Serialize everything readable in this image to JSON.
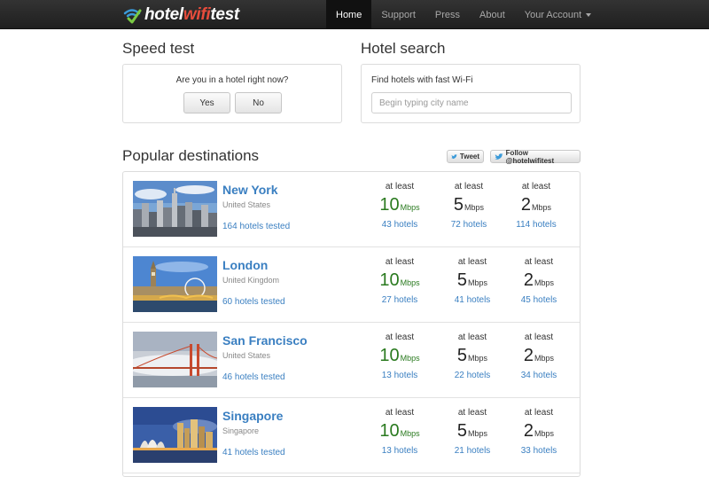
{
  "brand": {
    "prefix": "hotel",
    "wifi": "wifi",
    "suffix": "test"
  },
  "nav": {
    "items": [
      {
        "label": "Home"
      },
      {
        "label": "Support"
      },
      {
        "label": "Press"
      },
      {
        "label": "About"
      },
      {
        "label": "Your Account"
      }
    ]
  },
  "speed_test": {
    "heading": "Speed test",
    "question": "Are you in a hotel right now?",
    "yes": "Yes",
    "no": "No"
  },
  "hotel_search": {
    "heading": "Hotel search",
    "label": "Find hotels with fast Wi-Fi",
    "placeholder": "Begin typing city name"
  },
  "destinations": {
    "heading": "Popular destinations",
    "tweet": "Tweet",
    "follow": "Follow @hotelwifitest",
    "colors": {
      "link": "#3a7fc1",
      "green": "#2a7a1f"
    },
    "rows": [
      {
        "city": "New York",
        "country": "United States",
        "tested": "164 hotels tested",
        "stats": [
          {
            "lbl": "at least",
            "num": "10",
            "unit": "Mbps",
            "hotels": "43 hotels"
          },
          {
            "lbl": "at least",
            "num": "5",
            "unit": "Mbps",
            "hotels": "72 hotels"
          },
          {
            "lbl": "at least",
            "num": "2",
            "unit": "Mbps",
            "hotels": "114 hotels"
          }
        ]
      },
      {
        "city": "London",
        "country": "United Kingdom",
        "tested": "60 hotels tested",
        "stats": [
          {
            "lbl": "at least",
            "num": "10",
            "unit": "Mbps",
            "hotels": "27 hotels"
          },
          {
            "lbl": "at least",
            "num": "5",
            "unit": "Mbps",
            "hotels": "41 hotels"
          },
          {
            "lbl": "at least",
            "num": "2",
            "unit": "Mbps",
            "hotels": "45 hotels"
          }
        ]
      },
      {
        "city": "San Francisco",
        "country": "United States",
        "tested": "46 hotels tested",
        "stats": [
          {
            "lbl": "at least",
            "num": "10",
            "unit": "Mbps",
            "hotels": "13 hotels"
          },
          {
            "lbl": "at least",
            "num": "5",
            "unit": "Mbps",
            "hotels": "22 hotels"
          },
          {
            "lbl": "at least",
            "num": "2",
            "unit": "Mbps",
            "hotels": "34 hotels"
          }
        ]
      },
      {
        "city": "Singapore",
        "country": "Singapore",
        "tested": "41 hotels tested",
        "stats": [
          {
            "lbl": "at least",
            "num": "10",
            "unit": "Mbps",
            "hotels": "13 hotels"
          },
          {
            "lbl": "at least",
            "num": "5",
            "unit": "Mbps",
            "hotels": "21 hotels"
          },
          {
            "lbl": "at least",
            "num": "2",
            "unit": "Mbps",
            "hotels": "33 hotels"
          }
        ]
      }
    ]
  }
}
